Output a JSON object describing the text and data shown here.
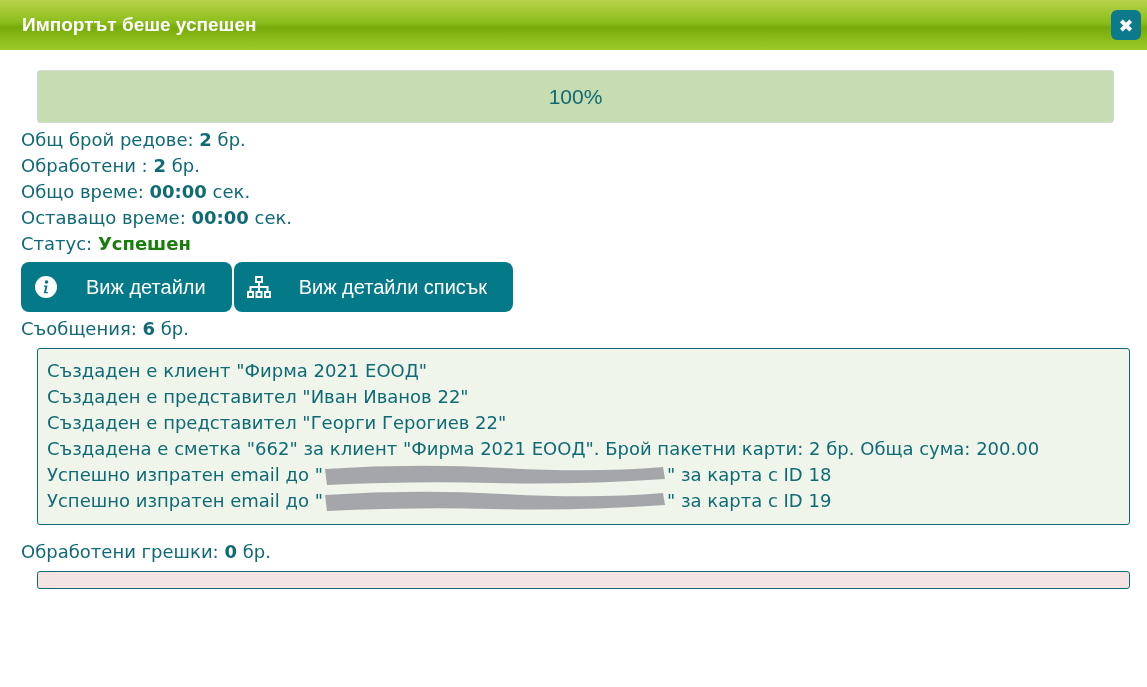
{
  "window": {
    "title": "Импортът беше успешен",
    "close": "✖"
  },
  "progress": {
    "level": 1,
    "reading": "100%"
  },
  "stats": [
    {
      "label": "Общ брой редове:",
      "value": "2",
      "unit": "бр.",
      "kind": "plain"
    },
    {
      "label": "Обработени :",
      "value": "2",
      "unit": "бр.",
      "kind": "plain"
    },
    {
      "label": "Общо време:",
      "value": "00:00",
      "unit": "сек.",
      "kind": "plain"
    },
    {
      "label": "Оставащо време:",
      "value": "00:00",
      "unit": "сек.",
      "kind": "plain"
    },
    {
      "label": "Статус:",
      "value": "Успешен",
      "kind": "status"
    }
  ],
  "buttons": [
    {
      "label": "Виж детайли",
      "kind": "info"
    },
    {
      "label": "Виж детайли списък",
      "kind": "tree"
    }
  ],
  "messages_count": {
    "label": "Съобщения:",
    "value": "6",
    "unit": "бр."
  },
  "messages": [
    {
      "kind": "text",
      "text": "Създаден е клиент \"Фирма 2021 ЕООД\""
    },
    {
      "kind": "text",
      "text": "Създаден е представител \"Иван Иванов 22\""
    },
    {
      "kind": "text",
      "text": "Създаден е представител \"Георги Герогиев 22\""
    },
    {
      "kind": "text",
      "text": "Създадена е сметка \"662\" за клиент \"Фирма 2021 ЕООД\". Брой пакетни карти: 2 бр. Обща сума: 200.00"
    },
    {
      "kind": "redacted",
      "before": "Успешно изпратен email до \"",
      "after": "\" за карта с ID 18"
    },
    {
      "kind": "redacted",
      "before": "Успешно изпратен email до \"",
      "after": "\" за карта с ID 19"
    }
  ],
  "errors_count": {
    "label": "Обработени грешки:",
    "value": "0",
    "unit": "бр."
  }
}
